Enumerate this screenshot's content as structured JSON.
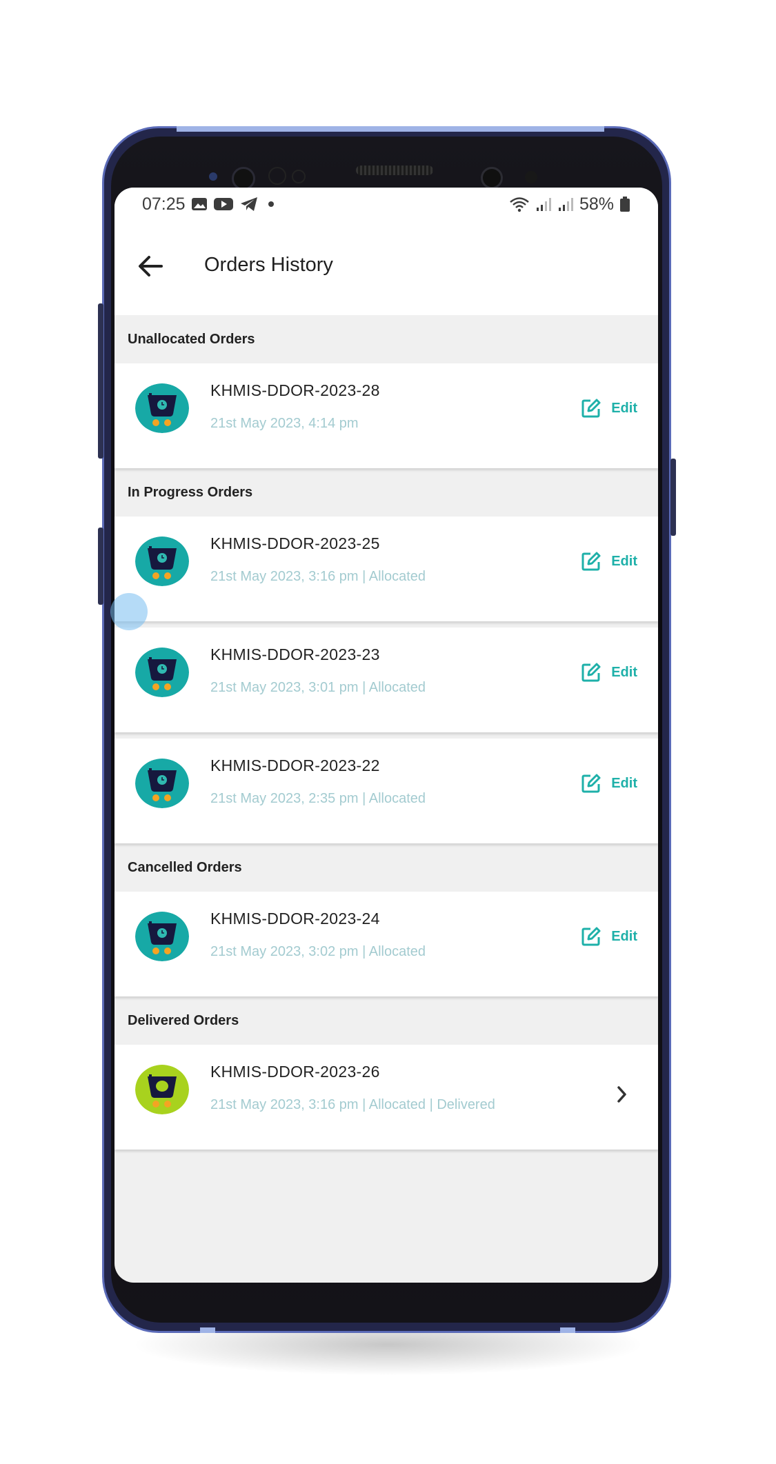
{
  "status_bar": {
    "time": "07:25",
    "battery": "58%"
  },
  "header": {
    "title": "Orders History"
  },
  "sections": {
    "unallocated": {
      "title": "Unallocated Orders",
      "orders": [
        {
          "id": "KHMIS-DDOR-2023-28",
          "meta": "21st May 2023, 4:14 pm",
          "action": "Edit"
        }
      ]
    },
    "in_progress": {
      "title": "In Progress Orders",
      "orders": [
        {
          "id": "KHMIS-DDOR-2023-25",
          "meta": "21st May 2023, 3:16 pm | Allocated",
          "action": "Edit"
        },
        {
          "id": "KHMIS-DDOR-2023-23",
          "meta": "21st May 2023, 3:01 pm | Allocated",
          "action": "Edit"
        },
        {
          "id": "KHMIS-DDOR-2023-22",
          "meta": "21st May 2023, 2:35 pm | Allocated",
          "action": "Edit"
        }
      ]
    },
    "cancelled": {
      "title": "Cancelled Orders",
      "orders": [
        {
          "id": "KHMIS-DDOR-2023-24",
          "meta": "21st May 2023, 3:02 pm | Allocated",
          "action": "Edit"
        }
      ]
    },
    "delivered": {
      "title": "Delivered Orders",
      "orders": [
        {
          "id": "KHMIS-DDOR-2023-26",
          "meta": "21st May 2023, 3:16 pm | Allocated | Delivered"
        }
      ]
    }
  },
  "icons": {
    "back": "arrow-left-icon",
    "edit": "edit-icon",
    "cart_pending": "cart-clock-icon",
    "cart_delivered": "cart-delivered-icon",
    "chevron": "chevron-right-icon"
  },
  "colors": {
    "accent": "#1eb0a9",
    "avatar_pending_bg": "#17a9a6",
    "avatar_delivered_bg": "#a8d21e",
    "cart_dark": "#16183e",
    "wheels": "#f4a423",
    "meta_text": "#a3cbd0"
  }
}
